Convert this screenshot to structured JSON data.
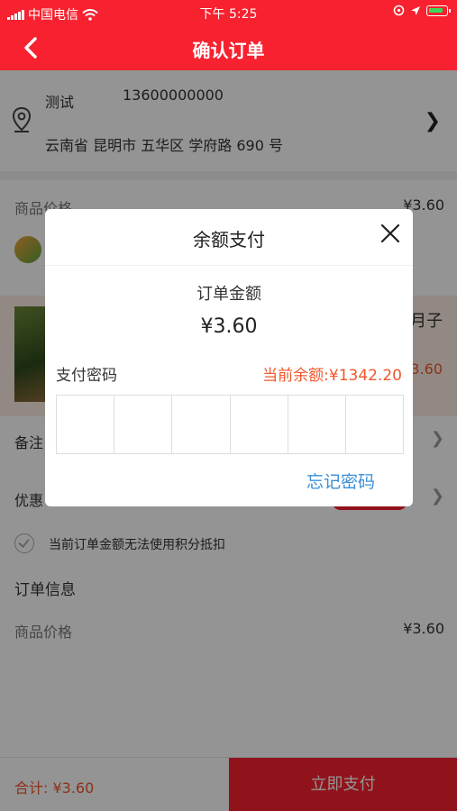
{
  "status_bar": {
    "carrier": "中国电信",
    "time": "下午 5:25"
  },
  "nav": {
    "title": "确认订单"
  },
  "address": {
    "name": "测试",
    "phone": "13600000000",
    "full": "云南省 昆明市 五华区 学府路 690 号"
  },
  "goods": {
    "price_label": "商品价格",
    "price_value": "¥3.60",
    "name_fragment": "月子",
    "unit_price": "¥3.60"
  },
  "remark_label": "备注",
  "coupon_label": "优惠",
  "points_notice": "当前订单金额无法使用积分抵扣",
  "order_info": {
    "title": "订单信息",
    "price_label": "商品价格",
    "price_value": "¥3.60"
  },
  "footer": {
    "total": "合计: ¥3.60",
    "pay_button": "立即支付"
  },
  "modal": {
    "title": "余额支付",
    "amount_label": "订单金额",
    "amount": "¥3.60",
    "password_label": "支付密码",
    "balance": "当前余额:¥1342.20",
    "password_boxes": 6,
    "forgot_password": "忘记密码"
  },
  "colors": {
    "brand_red": "#f8212f",
    "accent_orange": "#f0572b",
    "link_blue": "#3a8fd8"
  }
}
